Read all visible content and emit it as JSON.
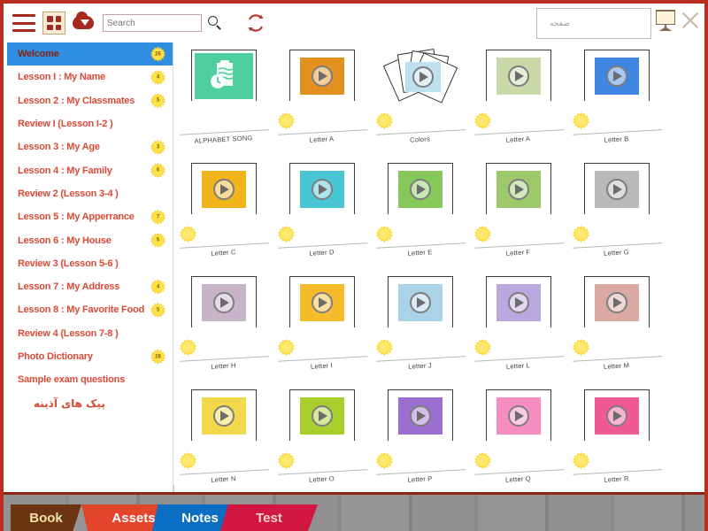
{
  "window": {
    "accent_color": "#b92d20",
    "present_icon": "presentation-screen-icon",
    "close_icon": "close-icon"
  },
  "toolbar": {
    "menu_icon": "hamburger-menu-icon",
    "grid_icon": "grid-view-icon",
    "download_icon": "cloud-download-icon",
    "refresh_icon": "refresh-icon",
    "search": {
      "value": "",
      "placeholder": "Search",
      "icon": "search-icon"
    },
    "page_field": {
      "value": "صفحه",
      "placeholder": "صفحه"
    }
  },
  "sidebar": {
    "items": [
      {
        "label": "Welcome",
        "badge": "26",
        "active": true,
        "rtl": false
      },
      {
        "label": "Lesson I : My Name",
        "badge": "4",
        "active": false,
        "rtl": false
      },
      {
        "label": "Lesson 2 : My Classmates",
        "badge": "5",
        "active": false,
        "rtl": false
      },
      {
        "label": "Review I (Lesson I-2 )",
        "badge": "",
        "active": false,
        "rtl": false
      },
      {
        "label": "Lesson 3 : My Age",
        "badge": "3",
        "active": false,
        "rtl": false
      },
      {
        "label": "Lesson 4 : My Family",
        "badge": "6",
        "active": false,
        "rtl": false
      },
      {
        "label": "Review 2 (Lesson 3-4 )",
        "badge": "",
        "active": false,
        "rtl": false
      },
      {
        "label": "Lesson 5 : My Apperrance",
        "badge": "7",
        "active": false,
        "rtl": false
      },
      {
        "label": "Lesson 6 : My House",
        "badge": "5",
        "active": false,
        "rtl": false
      },
      {
        "label": "Review 3 (Lesson 5-6 )",
        "badge": "",
        "active": false,
        "rtl": false
      },
      {
        "label": "Lesson 7 : My Address",
        "badge": "4",
        "active": false,
        "rtl": false
      },
      {
        "label": "Lesson 8 : My Favorite Food",
        "badge": "5",
        "active": false,
        "rtl": false
      },
      {
        "label": "Review 4 (Lesson 7-8 )",
        "badge": "",
        "active": false,
        "rtl": false
      },
      {
        "label": "Photo Dictionary",
        "badge": "28",
        "active": false,
        "rtl": false
      },
      {
        "label": "Sample exam questions",
        "badge": "",
        "active": false,
        "rtl": false
      },
      {
        "label": "پیک های آذینه",
        "badge": "",
        "active": false,
        "rtl": true
      }
    ]
  },
  "content": {
    "rows": [
      [
        {
          "label": "ALPHABET SONG",
          "kind": "doc",
          "color": "#4ecfa0",
          "sun": false
        },
        {
          "label": "Letter A",
          "kind": "video",
          "color": "#e2901f",
          "sun": true
        },
        {
          "label": "Colors",
          "kind": "papers",
          "color": "#bfe0ef",
          "sun": true
        },
        {
          "label": "Letter A",
          "kind": "video",
          "color": "#c9d9a8",
          "sun": true
        },
        {
          "label": "Letter B",
          "kind": "video",
          "color": "#3f86e0",
          "sun": true
        }
      ],
      [
        {
          "label": "Letter C",
          "kind": "video",
          "color": "#f0b41c",
          "sun": true
        },
        {
          "label": "Letter D",
          "kind": "video",
          "color": "#49c6d4",
          "sun": true
        },
        {
          "label": "Letter E",
          "kind": "video",
          "color": "#86c85a",
          "sun": true
        },
        {
          "label": "Letter F",
          "kind": "video",
          "color": "#9ec96b",
          "sun": true
        },
        {
          "label": "Letter G",
          "kind": "video",
          "color": "#b9b9b9",
          "sun": true
        }
      ],
      [
        {
          "label": "Letter H",
          "kind": "video",
          "color": "#c8b4c8",
          "sun": true
        },
        {
          "label": "Letter I",
          "kind": "video",
          "color": "#f5bb2a",
          "sun": true
        },
        {
          "label": "Letter J",
          "kind": "video",
          "color": "#aad3e8",
          "sun": true
        },
        {
          "label": "Letter L",
          "kind": "video",
          "color": "#b8a8dd",
          "sun": true
        },
        {
          "label": "Letter M",
          "kind": "video",
          "color": "#dba9a4",
          "sun": true
        }
      ],
      [
        {
          "label": "Letter N",
          "kind": "video",
          "color": "#f2d94c",
          "sun": true
        },
        {
          "label": "Letter O",
          "kind": "video",
          "color": "#a8cf2b",
          "sun": true
        },
        {
          "label": "Letter P",
          "kind": "video",
          "color": "#9b6fcf",
          "sun": true
        },
        {
          "label": "Letter Q",
          "kind": "video",
          "color": "#f58dc0",
          "sun": true
        },
        {
          "label": "Letter R",
          "kind": "video",
          "color": "#ef5a93",
          "sun": true
        }
      ]
    ]
  },
  "footer": {
    "tabs": [
      {
        "label": "Book",
        "active": false
      },
      {
        "label": "Assets",
        "active": true
      },
      {
        "label": "Notes",
        "active": false
      },
      {
        "label": "Test",
        "active": false
      }
    ]
  }
}
